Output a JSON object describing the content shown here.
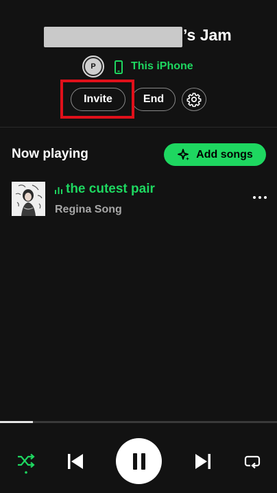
{
  "header": {
    "title_suffix": "’s Jam",
    "avatar_initial": "P",
    "device_label": "This iPhone"
  },
  "actions": {
    "invite_label": "Invite",
    "end_label": "End"
  },
  "now_playing": {
    "section_title": "Now playing",
    "add_songs_label": "Add songs",
    "track": {
      "title": "the cutest pair",
      "artist": "Regina Song"
    }
  },
  "playback": {
    "progress_fraction": 0.12,
    "is_playing": true,
    "shuffle_active": true
  },
  "colors": {
    "accent": "#1ed760",
    "background": "#121212",
    "highlight": "#e0101a"
  },
  "icons": [
    "device-phone-icon",
    "gear-icon",
    "sparkle-icon",
    "equalizer-icon",
    "more-icon",
    "shuffle-icon",
    "previous-icon",
    "pause-icon",
    "next-icon",
    "repeat-icon"
  ]
}
